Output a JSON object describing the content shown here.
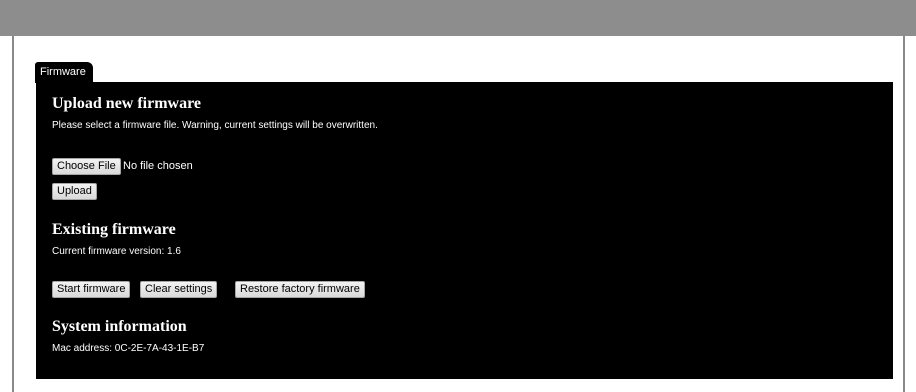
{
  "tabs": {
    "firmware_label": "Firmware"
  },
  "upload": {
    "title": "Upload new firmware",
    "description": "Please select a firmware file. Warning, current settings will be overwritten.",
    "choose_file_label": "Choose File",
    "file_status": "No file chosen",
    "upload_label": "Upload"
  },
  "existing": {
    "title": "Existing firmware",
    "version_text": "Current firmware version: 1.6",
    "start_label": "Start firmware",
    "clear_label": "Clear settings",
    "restore_label": "Restore factory firmware"
  },
  "system": {
    "title": "System information",
    "mac_text": "Mac address: 0C-2E-7A-43-1E-B7"
  },
  "colors": {
    "header_bar": "#8d8d8d",
    "panel": "#000000",
    "panel_text": "#ffffff",
    "button_face": "#e6e6e6"
  }
}
